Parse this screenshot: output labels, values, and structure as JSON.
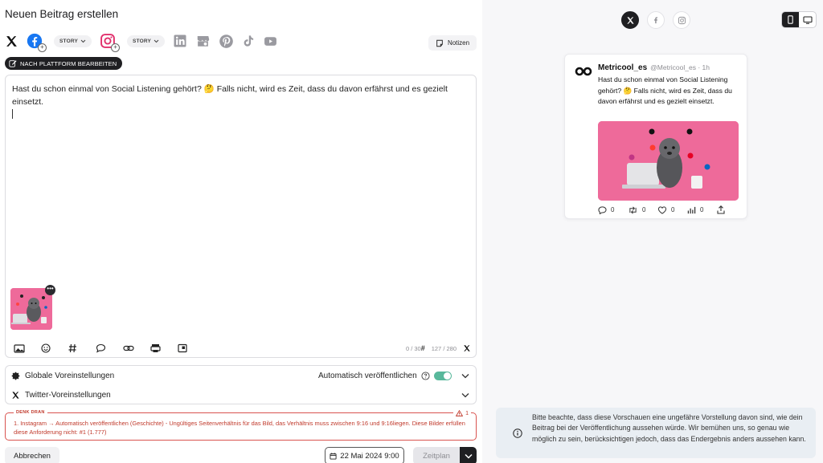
{
  "page": {
    "title": "Neuen Beitrag erstellen"
  },
  "platforms": {
    "story_label_facebook": "STORY",
    "story_label_instagram": "STORY",
    "items": [
      "twitter-x",
      "facebook",
      "instagram",
      "linkedin",
      "google-business",
      "pinterest",
      "tiktok",
      "youtube"
    ]
  },
  "notes": {
    "label": "Notizen"
  },
  "edit_per_platform": {
    "label": "NACH PLATTFORM BEARBEITEN"
  },
  "editor": {
    "text": "Hast du schon einmal von Social Listening gehört? 🤔 Falls nicht, wird es Zeit, dass du davon erfährst und es gezielt einsetzt.",
    "hashtag_count": "0 / 30",
    "char_count": "127 / 280"
  },
  "settings": {
    "global_label": "Globale Voreinstellungen",
    "auto_publish_label": "Automatisch veröffentlichen",
    "auto_publish_on": true,
    "twitter_label": "Twitter-Voreinstellungen"
  },
  "warning": {
    "title": "DENK DRAN",
    "count": "1",
    "text": "1. Instagram → Automatisch veröffentlichen (Geschichte) - Ungültiges Seitenverhältnis für das Bild, das Verhältnis muss zwischen 9:16 und 9:16liegen. Diese Bilder erfüllen diese Anforderung nicht: #1 (1.777)"
  },
  "footer": {
    "cancel_label": "Abbrechen",
    "date_label": "22 Mai 2024 9:00",
    "schedule_label": "Zeitplan"
  },
  "preview": {
    "account_name": "Metricool_es",
    "account_meta": "@Metricool_es · 1h",
    "text": "Hast du schon einmal von Social Listening gehört? 🤔 Falls nicht, wird es Zeit, dass du davon erfährst und es gezielt einsetzt.",
    "replies": "0",
    "retweets": "0",
    "likes": "0",
    "views": "0"
  },
  "notice": {
    "text": "Bitte beachte, dass diese Vorschauen eine ungefähre Vorstellung davon sind, wie dein Beitrag bei der Veröffentlichung aussehen würde. Wir bemühen uns, so genau wie möglich zu sein, berücksichtigen jedoch, dass das Endergebnis anders aussehen kann."
  },
  "colors": {
    "accent_dark": "#1f1f22",
    "toggle_green": "#58b89b",
    "warning_red": "#c0392b",
    "image_pink": "#ee6a9a"
  }
}
